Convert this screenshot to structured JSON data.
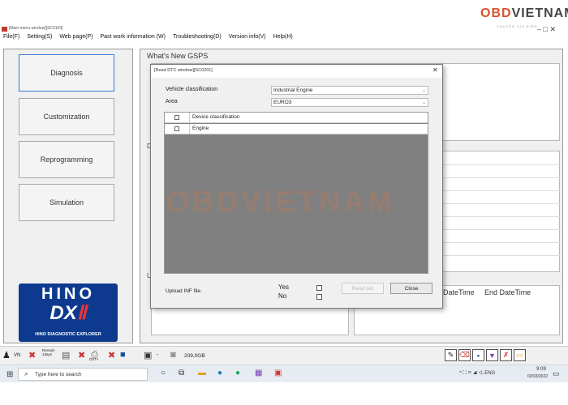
{
  "window": {
    "title": "[Main menu window][SC0103]",
    "controls": "–  □  ✕"
  },
  "brand": {
    "word1": "OBD",
    "word2": "VIETNAM",
    "sub": "CHUYÊN GIA ĐIỆN"
  },
  "menubar": [
    "File(F)",
    "Setting(S)",
    "Web page(P)",
    "Past work information (W)",
    "Troubleshooting(D)",
    "Version info(V)",
    "Help(H)"
  ],
  "nav": {
    "diagnosis": "Diagnosis",
    "customization": "Customization",
    "reprogramming": "Reprogramming",
    "simulation": "Simulation"
  },
  "logo": {
    "top": "HINO",
    "main": "DX",
    "mark": "Ⅱ",
    "caption": "HINO DIAGNOSTIC EXPLORER"
  },
  "main": {
    "whats_new": "What's New GSPS",
    "section2_initial": "D",
    "section3_initial": "U",
    "history": {
      "col_datetime": "DateTime",
      "col_end_datetime": "End DateTime"
    }
  },
  "dialog": {
    "title": "[Read DTC window][SC0201]",
    "vehicle_classification_label": "Vehicle classification",
    "vehicle_classification_value": "Industrial Engine",
    "area_label": "Area",
    "area_value": "EURO3",
    "grid_header": "Device classification",
    "rows": [
      "Engine"
    ],
    "upload_label": "Upload INF file.",
    "yes": "Yes",
    "no": "No",
    "read_out": "Read out",
    "close": "Close"
  },
  "watermark": "OBDVIETNAM",
  "statusbar": {
    "vn": "VN",
    "remain": "Remain",
    "remain_days": "1days",
    "dst": "DST-i",
    "dash": "-",
    "disk": "209,0GB"
  },
  "taskbar": {
    "search_placeholder": "Type here to search",
    "lang": "ENG",
    "time": "9:09",
    "date": "02/03/2022"
  }
}
